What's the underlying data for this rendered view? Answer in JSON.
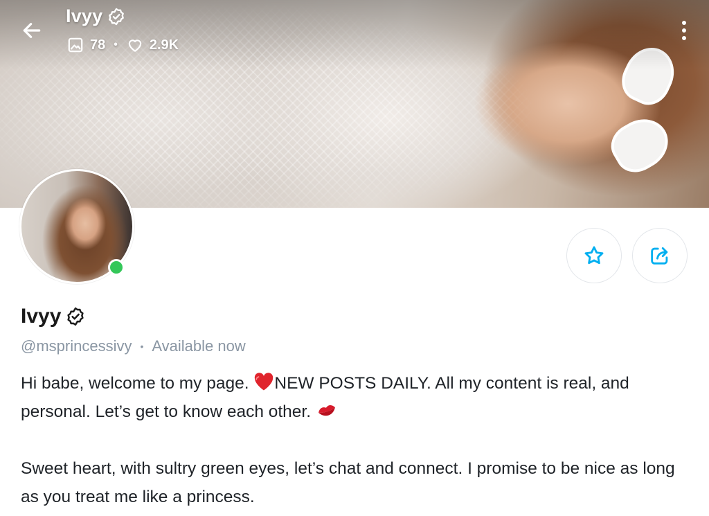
{
  "header": {
    "name": "Ivyy",
    "media_count": "78",
    "likes_count": "2.9K"
  },
  "profile": {
    "display_name": "Ivyy",
    "handle": "@msprincessivy",
    "status": "Available now",
    "online": true
  },
  "bio": {
    "line1_a": "Hi babe, welcome to my page. ",
    "line1_b": "NEW POSTS DAILY. All my content is real, and personal. Let’s get to know each other. ",
    "line2": "Sweet heart, with sultry green eyes, let’s chat and connect. I promise to be nice as long as you treat me like a princess."
  },
  "icons": {
    "back": "arrow-left-icon",
    "verified": "verified-badge-icon",
    "media": "image-icon",
    "likes": "heart-icon",
    "more": "more-vertical-icon",
    "favorite": "star-icon",
    "share": "share-icon"
  },
  "colors": {
    "accent": "#00aff0",
    "online": "#34c759",
    "muted_text": "#8a96a3",
    "heart_emoji": "#e0242c"
  }
}
